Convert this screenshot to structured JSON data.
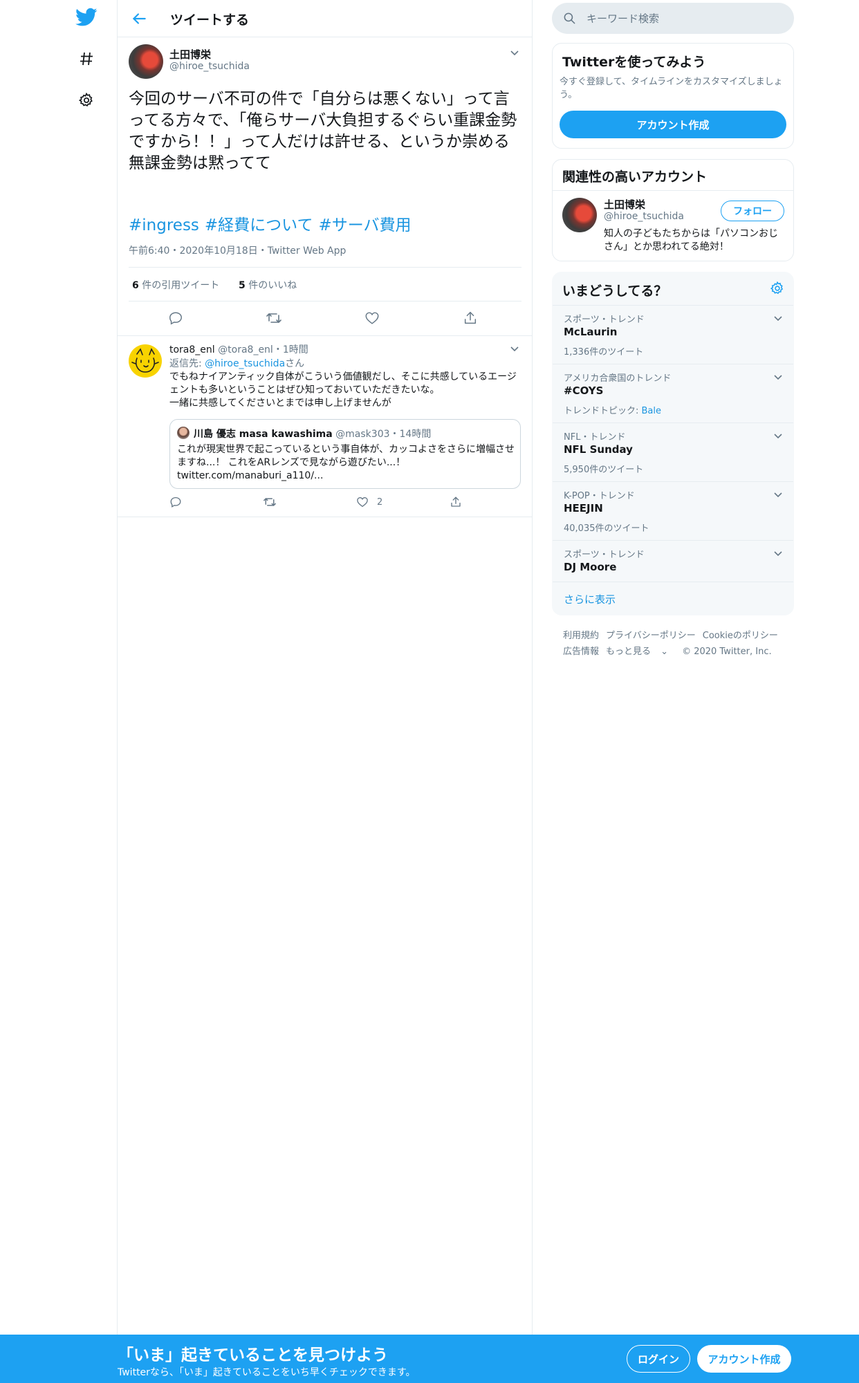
{
  "colors": {
    "brand": "#1da1f2",
    "link": "#1b95e0",
    "muted": "#657786",
    "border": "#e6ecf0"
  },
  "nav": {
    "icons": [
      "twitter-bird-icon",
      "hashtag-icon",
      "gear-icon"
    ]
  },
  "header": {
    "title": "ツイートする"
  },
  "main_tweet": {
    "name": "土田博栄",
    "handle": "@hiroe_tsuchida",
    "text": "今回のサーバ不可の件で「自分らは悪くない」って言ってる方々で、「俺らサーバ大負担するぐらい重課金勢ですから！！」って人だけは許せる、というか崇める\n無課金勢は黙ってて",
    "hashtags": [
      "#ingress",
      "#経費について",
      "#サーバ費用"
    ],
    "meta": "午前6:40・2020年10月18日・Twitter Web App",
    "stats": {
      "quotes_count": "6",
      "quotes_label": " 件の引用ツイート",
      "likes_count": "5",
      "likes_label": " 件のいいね"
    }
  },
  "reply": {
    "name": "tora8_enl",
    "handle": "@tora8_enl",
    "time": "・1時間",
    "reply_to_prefix": "返信先: ",
    "reply_to_handle": "@hiroe_tsuchida",
    "reply_to_suffix": "さん",
    "text": "でもねナイアンティック自体がこういう価値観だし、そこに共感しているエージェントも多いということはぜひ知っておいていただきたいな。\n一緒に共感してくださいとまでは申し上げませんが",
    "quote": {
      "name": "川島 優志 masa kawashima",
      "handle": "@mask303",
      "time": "・14時間",
      "text": "これが現実世界で起こっているという事自体が、カッコよさをさらに増幅させますね...！ これをARレンズで見ながら遊びたい...！\ntwitter.com/manaburi_a110/..."
    },
    "likes": "2"
  },
  "search": {
    "placeholder": "キーワード検索"
  },
  "signup_card": {
    "title": "Twitterを使ってみよう",
    "description": "今すぐ登録して、タイムラインをカスタマイズしましょう。",
    "button": "アカウント作成"
  },
  "related_card": {
    "title": "関連性の高いアカウント",
    "name": "土田博栄",
    "handle": "@hiroe_tsuchida",
    "follow": "フォロー",
    "bio": "知人の子どもたちからは「パソコンおじさん」とか思われてる絶対！"
  },
  "trends_card": {
    "title": "いまどうしてる？",
    "items": [
      {
        "context": "スポーツ・トレンド",
        "name": "McLaurin",
        "count": "1,336件のツイート"
      },
      {
        "context": "アメリカ合衆国のトレンド",
        "name": "#COYS",
        "count_prefix": "トレンドトピック: ",
        "count_link": "Bale"
      },
      {
        "context": "NFL・トレンド",
        "name": "NFL Sunday",
        "count": "5,950件のツイート"
      },
      {
        "context": "K-POP・トレンド",
        "name": "HEEJIN",
        "count": "40,035件のツイート"
      },
      {
        "context": "スポーツ・トレンド",
        "name": "DJ Moore"
      }
    ],
    "show_more": "さらに表示"
  },
  "footer": {
    "links": [
      "利用規約",
      "プライバシーポリシー",
      "Cookieのポリシー",
      "広告情報",
      "もっと見る"
    ],
    "copyright": "© 2020 Twitter, Inc."
  },
  "bottom_bar": {
    "title": "「いま」起きていることを見つけよう",
    "subtitle": "Twitterなら、「いま」起きていることをいち早くチェックできます。",
    "login": "ログイン",
    "signup": "アカウント作成"
  }
}
